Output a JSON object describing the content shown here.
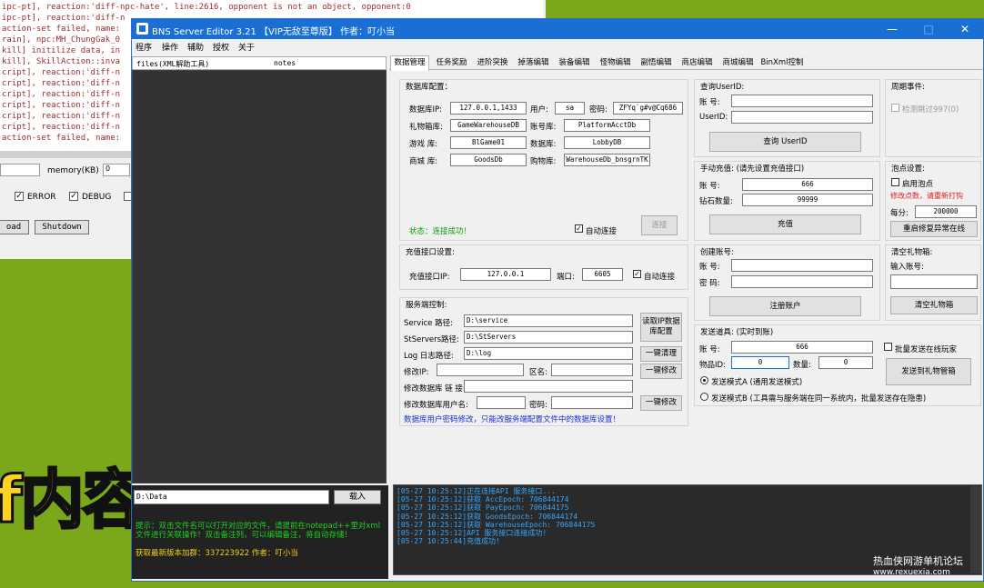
{
  "background_window": {
    "log_lines": [
      "ipc-pt], reaction:'diff-npc-hate', line:2616, opponent is not an object, opponent:0",
      "ipc-pt], reaction:'diff-n",
      "action-set failed, name:",
      "rain], npc:MH_ChungGak_0",
      "kill] initilize data, in",
      "kill], SkillAction::inva",
      "cript], reaction:'diff-n",
      "cript], reaction:'diff-n",
      "cript], reaction:'diff-n",
      "cript], reaction:'diff-n",
      "cript], reaction:'diff-n",
      "cript], reaction:'diff-n",
      "action-set failed, name:"
    ],
    "memory_label": "memory(KB)",
    "memory_value": "0",
    "error_label": "ERROR",
    "debug_label": "DEBUG",
    "load_button": "oad",
    "shutdown_button": "Shutdown",
    "big_text": "f内容"
  },
  "window": {
    "title": "BNS Server Editor 3.21  【VIP无敌至尊版】 作者：叮小当",
    "minimize": "—",
    "maximize": "□",
    "close": "✕"
  },
  "menu": [
    "程序",
    "操作",
    "辅助",
    "授权",
    "关于"
  ],
  "file_panel": {
    "col1": "files(XML解助工具)",
    "col2": "notes",
    "path_value": "D:\\Data",
    "load_button": "载入",
    "hint": "提示：双击文件名可以打开对应的文件，请提前在notepad++里对xml文件进行关联操作！双击备注列，可以编辑备注，将自动存储！",
    "latest": "获取最新版本加群：337223922 作者：叮小当"
  },
  "tabs": [
    "数据管理",
    "任务奖励",
    "进阶突换",
    "掉落编辑",
    "装备编辑",
    "怪物编辑",
    "副悟编辑",
    "商店编辑",
    "商城编辑",
    "BinXml控制"
  ],
  "db_config": {
    "title": "数据库配置：",
    "ip_label": "数据库IP:",
    "ip_value": "127.0.0.1,1433",
    "user_label": "用户:",
    "user_value": "sa",
    "pwd_label": "密码:",
    "pwd_value": "ZFYq`g#v@Cq686",
    "gift_label": "礼物箱库:",
    "gift_value": "GameWarehouseDB",
    "acct_label": "账号库:",
    "acct_value": "PlatformAcctDb",
    "game_label": "游戏  库:",
    "game_value": "BlGame01",
    "data_label": "数据库:",
    "data_value": "LobbyDB",
    "mall_label": "商城  库:",
    "mall_value": "GoodsDb",
    "buy_label": "购物库:",
    "buy_value": "WarehouseDb_bnsgrnTK",
    "status": "状态：连接成功！",
    "auto_label": "自动连接",
    "connect_button": "连接"
  },
  "query_user": {
    "title": "查询UserID:",
    "acct_label": "账  号:",
    "userid_label": "UserID:",
    "button": "查询 UserID"
  },
  "cycle_event": {
    "title": "周期事件:",
    "skip_label": "检测跳过997(0)"
  },
  "recharge": {
    "title": "手动充值: (请先设置充值接口)",
    "acct_label": "账  号:",
    "acct_value": "666",
    "amount_label": "钻石数量:",
    "amount_value": "99999",
    "button": "充值"
  },
  "bubble": {
    "title": "泡点设置:",
    "enable_label": "启用泡点",
    "warn": "修改点数，请重新打钩",
    "each_label": "每分:",
    "each_value": "200000",
    "restart_button": "重启修复异常在线"
  },
  "recharge_api": {
    "title": "充值接口设置:",
    "ip_label": "充值接口IP:",
    "ip_value": "127.0.0.1",
    "port_label": "端口:",
    "port_value": "6605",
    "auto_label": "自动连接"
  },
  "create_account": {
    "title": "创建账号:",
    "acct_label": "账  号:",
    "pwd_label": "密  码:",
    "button": "注册账户"
  },
  "clear_gift": {
    "title": "清空礼物箱:",
    "input_label": "输入账号:",
    "button": "清空礼物箱"
  },
  "server_ctrl": {
    "title": "服务端控制:",
    "service_label": "Service  路径:",
    "service_value": "D:\\service",
    "st_label": "StServers路径:",
    "st_value": "D:\\StServers",
    "log_label": "Log  日志路径:",
    "log_value": "D:\\log",
    "read_button": "读取IP数据库配置",
    "clean_button": "一键清理",
    "ip_label": "修改IP:",
    "area_label": "区名:",
    "modify_button": "一键修改",
    "db_link_label": "修改数据库 链 接:",
    "db_user_label": "修改数据库用户名:",
    "db_pwd_label": "密码:",
    "modify2_button": "一键修改",
    "note": "数据库用户密码修改，只能改服务端配置文件中的数据库设置！"
  },
  "send_item": {
    "title": "发送道具: (实时到账)",
    "acct_label": "账  号:",
    "acct_value": "666",
    "item_label": "物品ID:",
    "item_value": "0",
    "qty_label": "数量:",
    "qty_value": "0",
    "batch_label": "批量发送在线玩家",
    "send_button": "发送到礼物管箱",
    "mode_a": "发送模式A (通用发送模式)",
    "mode_b": "发送模式B (工具需与服务端在同一系统内，批量发送存在隐患)"
  },
  "log_lines": [
    "[05-27 10:25:12]正在连接API 服务接口...",
    "[05-27 10:25:12]获取 AccEpoch: 706844174",
    "[05-27 10:25:12]获取 PayEpoch: 706844175",
    "[05-27 10:25:12]获取 GoodsEpoch: 706844174",
    "[05-27 10:25:12]获取 WarehouseEpoch: 706844175",
    "[05-27 10:25:12]API 服务接口连接成功!",
    "[05-27 10:25:44]充值成功!"
  ],
  "watermark": {
    "name": "热血侠网游单机论坛",
    "url": "www.rexuexia.com"
  }
}
